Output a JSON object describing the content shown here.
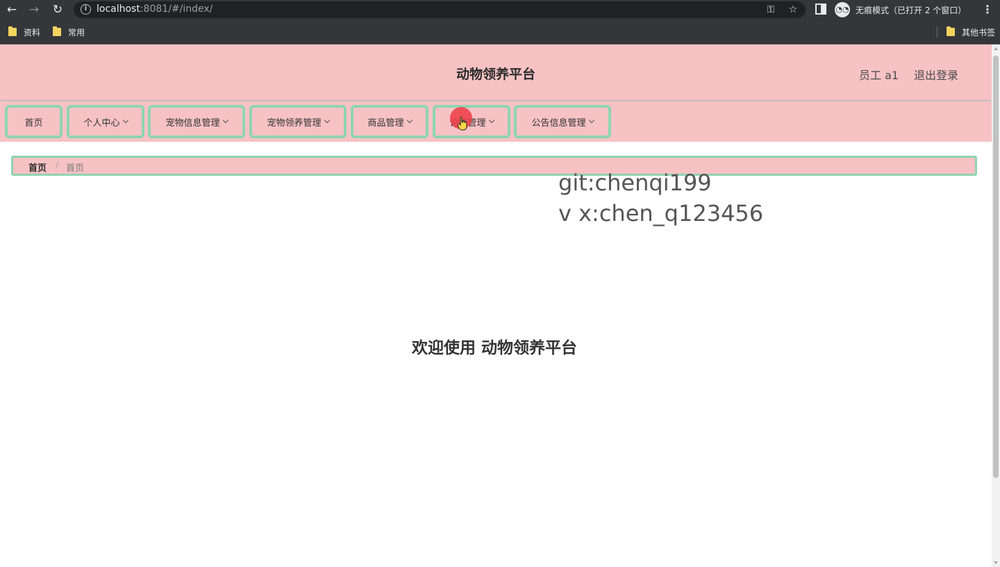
{
  "browser": {
    "back_icon": "←",
    "forward_icon": "→",
    "reload_icon": "↻",
    "url_host": "localhost",
    "url_path": ":8081/#/index/",
    "key_icon": "⚿",
    "star_icon": "☆",
    "incognito_icon": "◔◔",
    "incognito_label": "无痕模式（已打开 2 个窗口）",
    "menu_icon": "⋮"
  },
  "bookmarks": {
    "items": [
      {
        "label": "资料"
      },
      {
        "label": "常用"
      }
    ],
    "other": "其他书签"
  },
  "header": {
    "title": "动物领养平台",
    "user": "员工 a1",
    "logout": "退出登录"
  },
  "menu": {
    "items": [
      {
        "label": "首页"
      },
      {
        "label": "个人中心"
      },
      {
        "label": "宠物信息管理"
      },
      {
        "label": "宠物领养管理"
      },
      {
        "label": "商品管理"
      },
      {
        "label": "论坛管理"
      },
      {
        "label": "公告信息管理"
      }
    ]
  },
  "breadcrumb": {
    "home": "首页",
    "separator": "/",
    "current": "首页"
  },
  "watermark": {
    "line1": "git:chenqi199",
    "line2": "v x:chen_q123456"
  },
  "main": {
    "welcome": "欢迎使用 动物领养平台"
  },
  "colors": {
    "header_bg": "#f7c2c4",
    "menu_border": "#8fd4b0",
    "chrome_bg": "#35363a"
  }
}
